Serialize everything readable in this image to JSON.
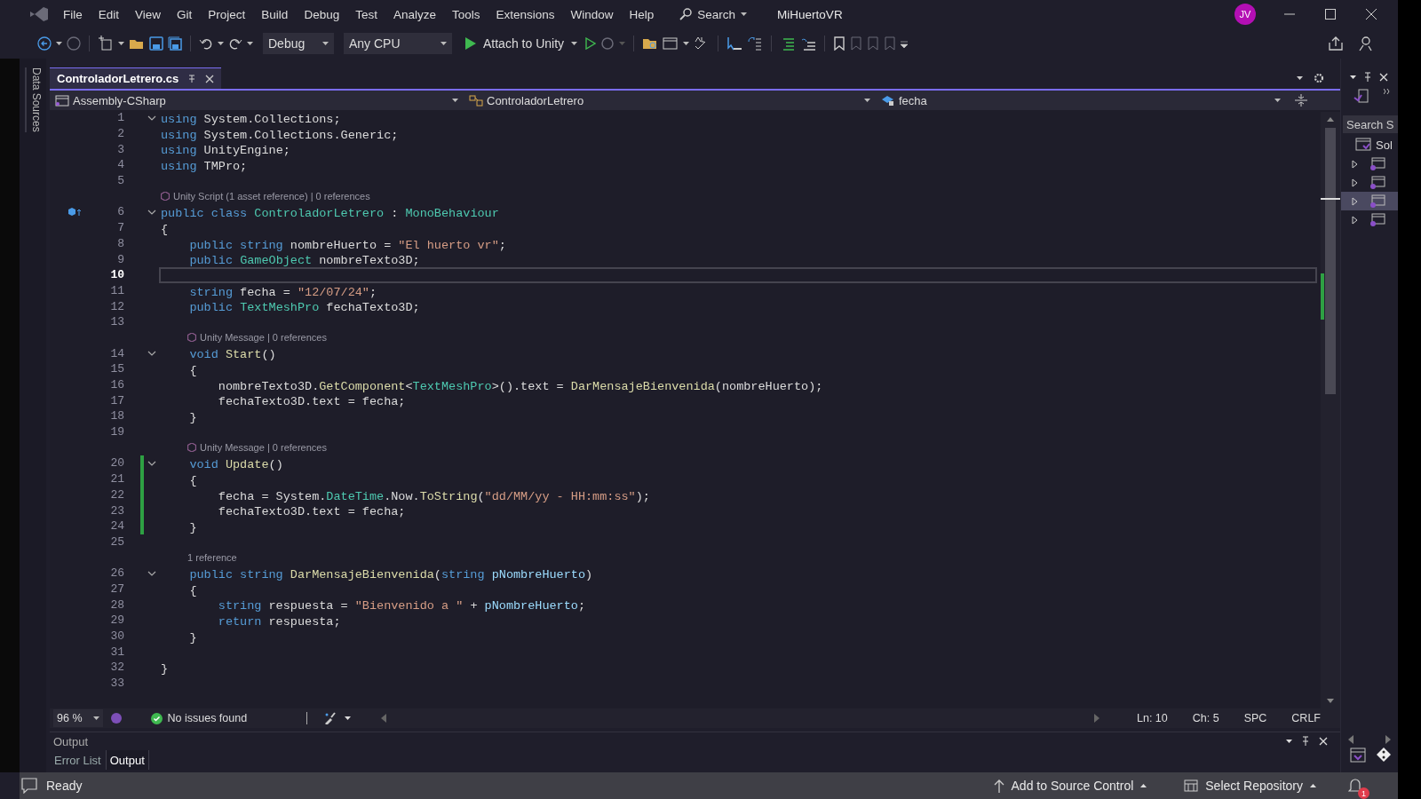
{
  "menu": [
    "File",
    "Edit",
    "View",
    "Git",
    "Project",
    "Build",
    "Debug",
    "Test",
    "Analyze",
    "Tools",
    "Extensions",
    "Window",
    "Help"
  ],
  "search": {
    "label": "Search"
  },
  "solution_name": "MiHuertoVR",
  "account": {
    "initials": "JV"
  },
  "toolbar": {
    "configuration": "Debug",
    "platform": "Any CPU",
    "run_target": "Attach to Unity"
  },
  "side_tab": {
    "label": "Data Sources"
  },
  "document_tabs": [
    {
      "label": "ControladorLetrero.cs",
      "selected": true
    }
  ],
  "navigation_bar": {
    "project": "Assembly-CSharp",
    "type": "ControladorLetrero",
    "member": "fecha"
  },
  "editor": {
    "lines": [
      {
        "kind": "code",
        "number": "1",
        "code": [
          {
            "kind": "keyword",
            "text": "using"
          },
          {
            "kind": "plain",
            "text": " System.Collections;"
          }
        ],
        "foldable": true,
        "modified": false,
        "current": false,
        "glyph": false
      },
      {
        "kind": "code",
        "number": "2",
        "code": [
          {
            "kind": "keyword",
            "text": "using"
          },
          {
            "kind": "plain",
            "text": " System.Collections.Generic;"
          }
        ],
        "foldable": false,
        "modified": false,
        "current": false,
        "glyph": false
      },
      {
        "kind": "code",
        "number": "3",
        "code": [
          {
            "kind": "keyword",
            "text": "using"
          },
          {
            "kind": "plain",
            "text": " UnityEngine;"
          }
        ],
        "foldable": false,
        "modified": false,
        "current": false,
        "glyph": false
      },
      {
        "kind": "code",
        "number": "4",
        "code": [
          {
            "kind": "keyword",
            "text": "using"
          },
          {
            "kind": "plain",
            "text": " TMPro;"
          }
        ],
        "foldable": false,
        "modified": false,
        "current": false,
        "glyph": false
      },
      {
        "kind": "code",
        "number": "5",
        "foldable": false,
        "modified": false,
        "current": false,
        "glyph": false
      },
      {
        "kind": "lens",
        "text": "Unity Script (1 asset reference) | 0 references",
        "unity_icon": true
      },
      {
        "kind": "code",
        "number": "6",
        "code": [
          {
            "kind": "keyword",
            "text": "public class "
          },
          {
            "kind": "type",
            "text": "ControladorLetrero"
          },
          {
            "kind": "plain",
            "text": " : "
          },
          {
            "kind": "type",
            "text": "MonoBehaviour"
          }
        ],
        "foldable": true,
        "modified": false,
        "current": false,
        "glyph": true
      },
      {
        "kind": "code",
        "number": "7",
        "code": [
          {
            "kind": "plain",
            "text": "{"
          }
        ],
        "foldable": false,
        "modified": false,
        "current": false,
        "glyph": false
      },
      {
        "kind": "code",
        "number": "8",
        "code": [
          {
            "kind": "keyword",
            "text": "    public string"
          },
          {
            "kind": "plain",
            "text": " nombreHuerto = "
          },
          {
            "kind": "string",
            "text": "\"El huerto vr\""
          },
          {
            "kind": "plain",
            "text": ";"
          }
        ],
        "foldable": false,
        "modified": false,
        "current": false,
        "glyph": false
      },
      {
        "kind": "code",
        "number": "9",
        "code": [
          {
            "kind": "keyword",
            "text": "    public "
          },
          {
            "kind": "type",
            "text": "GameObject"
          },
          {
            "kind": "plain",
            "text": " nombreTexto3D;"
          }
        ],
        "foldable": false,
        "modified": false,
        "current": false,
        "glyph": false
      },
      {
        "kind": "code",
        "number": "10",
        "foldable": false,
        "modified": false,
        "current": true,
        "glyph": false
      },
      {
        "kind": "code",
        "number": "11",
        "code": [
          {
            "kind": "keyword",
            "text": "    string"
          },
          {
            "kind": "plain",
            "text": " fecha = "
          },
          {
            "kind": "string",
            "text": "\"12/07/24\""
          },
          {
            "kind": "plain",
            "text": ";"
          }
        ],
        "foldable": false,
        "modified": false,
        "current": false,
        "glyph": false
      },
      {
        "kind": "code",
        "number": "12",
        "code": [
          {
            "kind": "keyword",
            "text": "    public "
          },
          {
            "kind": "type",
            "text": "TextMeshPro"
          },
          {
            "kind": "plain",
            "text": " fechaTexto3D;"
          }
        ],
        "foldable": false,
        "modified": false,
        "current": false,
        "glyph": false
      },
      {
        "kind": "code",
        "number": "13",
        "foldable": false,
        "modified": false,
        "current": false,
        "glyph": false
      },
      {
        "kind": "lens",
        "text": "Unity Message | 0 references",
        "unity_icon": true
      },
      {
        "kind": "code",
        "number": "14",
        "code": [
          {
            "kind": "keyword",
            "text": "    void "
          },
          {
            "kind": "method",
            "text": "Start"
          },
          {
            "kind": "plain",
            "text": "()"
          }
        ],
        "foldable": true,
        "modified": false,
        "current": false,
        "glyph": false
      },
      {
        "kind": "code",
        "number": "15",
        "code": [
          {
            "kind": "plain",
            "text": "    {"
          }
        ],
        "foldable": false,
        "modified": false,
        "current": false,
        "glyph": false
      },
      {
        "kind": "code",
        "number": "16",
        "code": [
          {
            "kind": "plain",
            "text": "        nombreTexto3D."
          },
          {
            "kind": "method",
            "text": "GetComponent"
          },
          {
            "kind": "plain",
            "text": "<"
          },
          {
            "kind": "type",
            "text": "TextMeshPro"
          },
          {
            "kind": "plain",
            "text": ">().text = "
          },
          {
            "kind": "method",
            "text": "DarMensajeBienvenida"
          },
          {
            "kind": "plain",
            "text": "(nombreHuerto);"
          }
        ],
        "foldable": false,
        "modified": false,
        "current": false,
        "glyph": false
      },
      {
        "kind": "code",
        "number": "17",
        "code": [
          {
            "kind": "plain",
            "text": "        fechaTexto3D.text = fecha;"
          }
        ],
        "foldable": false,
        "modified": false,
        "current": false,
        "glyph": false
      },
      {
        "kind": "code",
        "number": "18",
        "code": [
          {
            "kind": "plain",
            "text": "    }"
          }
        ],
        "foldable": false,
        "modified": false,
        "current": false,
        "glyph": false
      },
      {
        "kind": "code",
        "number": "19",
        "foldable": false,
        "modified": false,
        "current": false,
        "glyph": false
      },
      {
        "kind": "lens",
        "text": "Unity Message | 0 references",
        "unity_icon": true
      },
      {
        "kind": "code",
        "number": "20",
        "code": [
          {
            "kind": "keyword",
            "text": "    void "
          },
          {
            "kind": "method",
            "text": "Update"
          },
          {
            "kind": "plain",
            "text": "()"
          }
        ],
        "foldable": true,
        "modified": true,
        "current": false,
        "glyph": false
      },
      {
        "kind": "code",
        "number": "21",
        "code": [
          {
            "kind": "plain",
            "text": "    {"
          }
        ],
        "foldable": false,
        "modified": true,
        "current": false,
        "glyph": false
      },
      {
        "kind": "code",
        "number": "22",
        "code": [
          {
            "kind": "plain",
            "text": "        fecha = System."
          },
          {
            "kind": "type",
            "text": "DateTime"
          },
          {
            "kind": "plain",
            "text": ".Now."
          },
          {
            "kind": "method",
            "text": "ToString"
          },
          {
            "kind": "plain",
            "text": "("
          },
          {
            "kind": "string",
            "text": "\"dd/MM/yy - HH:mm:ss\""
          },
          {
            "kind": "plain",
            "text": ");"
          }
        ],
        "foldable": false,
        "modified": true,
        "current": false,
        "glyph": false
      },
      {
        "kind": "code",
        "number": "23",
        "code": [
          {
            "kind": "plain",
            "text": "        fechaTexto3D.text = fecha;"
          }
        ],
        "foldable": false,
        "modified": true,
        "current": false,
        "glyph": false
      },
      {
        "kind": "code",
        "number": "24",
        "code": [
          {
            "kind": "plain",
            "text": "    }"
          }
        ],
        "foldable": false,
        "modified": true,
        "current": false,
        "glyph": false
      },
      {
        "kind": "code",
        "number": "25",
        "foldable": false,
        "modified": false,
        "current": false,
        "glyph": false
      },
      {
        "kind": "lens",
        "text": "1 reference",
        "unity_icon": false
      },
      {
        "kind": "code",
        "number": "26",
        "code": [
          {
            "kind": "keyword",
            "text": "    public string "
          },
          {
            "kind": "method",
            "text": "DarMensajeBienvenida"
          },
          {
            "kind": "plain",
            "text": "("
          },
          {
            "kind": "keyword",
            "text": "string "
          },
          {
            "kind": "parameter",
            "text": "pNombreHuerto"
          },
          {
            "kind": "plain",
            "text": ")"
          }
        ],
        "foldable": true,
        "modified": false,
        "current": false,
        "glyph": false
      },
      {
        "kind": "code",
        "number": "27",
        "code": [
          {
            "kind": "plain",
            "text": "    {"
          }
        ],
        "foldable": false,
        "modified": false,
        "current": false,
        "glyph": false
      },
      {
        "kind": "code",
        "number": "28",
        "code": [
          {
            "kind": "keyword",
            "text": "        string"
          },
          {
            "kind": "plain",
            "text": " respuesta = "
          },
          {
            "kind": "string",
            "text": "\"Bienvenido a \""
          },
          {
            "kind": "plain",
            "text": " + "
          },
          {
            "kind": "parameter",
            "text": "pNombreHuerto"
          },
          {
            "kind": "plain",
            "text": ";"
          }
        ],
        "foldable": false,
        "modified": false,
        "current": false,
        "glyph": false
      },
      {
        "kind": "code",
        "number": "29",
        "code": [
          {
            "kind": "keyword",
            "text": "        return"
          },
          {
            "kind": "plain",
            "text": " respuesta;"
          }
        ],
        "foldable": false,
        "modified": false,
        "current": false,
        "glyph": false
      },
      {
        "kind": "code",
        "number": "30",
        "code": [
          {
            "kind": "plain",
            "text": "    }"
          }
        ],
        "foldable": false,
        "modified": false,
        "current": false,
        "glyph": false
      },
      {
        "kind": "code",
        "number": "31",
        "foldable": false,
        "modified": false,
        "current": false,
        "glyph": false
      },
      {
        "kind": "code",
        "number": "32",
        "code": [
          {
            "kind": "plain",
            "text": "}"
          }
        ],
        "foldable": false,
        "modified": false,
        "current": false,
        "glyph": false
      },
      {
        "kind": "code",
        "number": "33",
        "foldable": false,
        "modified": false,
        "current": false,
        "glyph": false
      }
    ]
  },
  "editor_status": {
    "zoom": "96 %",
    "issues": "No issues found",
    "line": "Ln: 10",
    "column": "Ch: 5",
    "whitespace": "SPC",
    "line_ending": "CRLF"
  },
  "solution_explorer": {
    "search_placeholder": "Search S",
    "root": "Sol",
    "items": [
      {
        "expanded": false,
        "selected": false
      },
      {
        "expanded": false,
        "selected": false
      },
      {
        "expanded": false,
        "selected": true
      },
      {
        "expanded": false,
        "selected": false
      }
    ]
  },
  "output_panel": {
    "title": "Output",
    "tabs": [
      {
        "label": "Error List",
        "selected": false
      },
      {
        "label": "Output",
        "selected": true
      }
    ]
  },
  "status_bar": {
    "text": "Ready",
    "source_control": "Add to Source Control",
    "repository": "Select Repository",
    "notifications": "1"
  }
}
